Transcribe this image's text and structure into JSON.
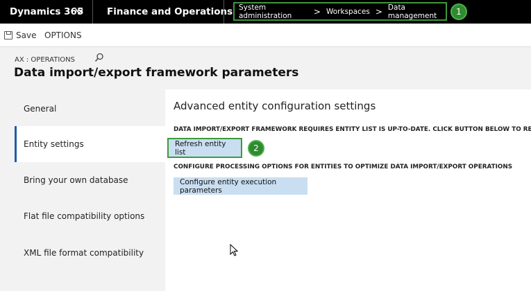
{
  "topbar": {
    "brand": "Dynamics 365",
    "module": "Finance and Operations",
    "breadcrumb": [
      "System administration",
      "Workspaces",
      "Data management"
    ],
    "breadcrumb_separator": ">",
    "badge1": "1"
  },
  "actionbar": {
    "save_label": "Save",
    "options_label": "OPTIONS"
  },
  "header": {
    "company": "AX : OPERATIONS",
    "title": "Data import/export framework parameters"
  },
  "leftnav": {
    "items": [
      {
        "label": "General"
      },
      {
        "label": "Entity settings"
      },
      {
        "label": "Bring your own database"
      },
      {
        "label": "Flat file compatibility options"
      },
      {
        "label": "XML file format compatibility"
      }
    ],
    "active_index": 1
  },
  "content": {
    "section_title": "Advanced entity configuration settings",
    "refresh_caption": "DATA IMPORT/EXPORT FRAMEWORK REQUIRES ENTITY LIST IS UP-TO-DATE. CLICK BUTTON BELOW TO REFRESH",
    "refresh_button": "Refresh entity list",
    "badge2": "2",
    "configure_caption": "CONFIGURE PROCESSING OPTIONS FOR ENTITIES TO OPTIMIZE DATA IMPORT/EXPORT OPERATIONS",
    "configure_button": "Configure entity execution parameters"
  },
  "colors": {
    "topbar_bg": "#000000",
    "highlight_green": "#3c9a3c",
    "badge_green": "#2e8b2e",
    "button_bg": "#c9def1",
    "nav_active_accent": "#1e5aa8"
  },
  "icons": {
    "brand_dropdown": "chevron-down-icon",
    "save": "save-icon",
    "search": "search-icon",
    "cursor": "mouse-pointer-icon"
  }
}
